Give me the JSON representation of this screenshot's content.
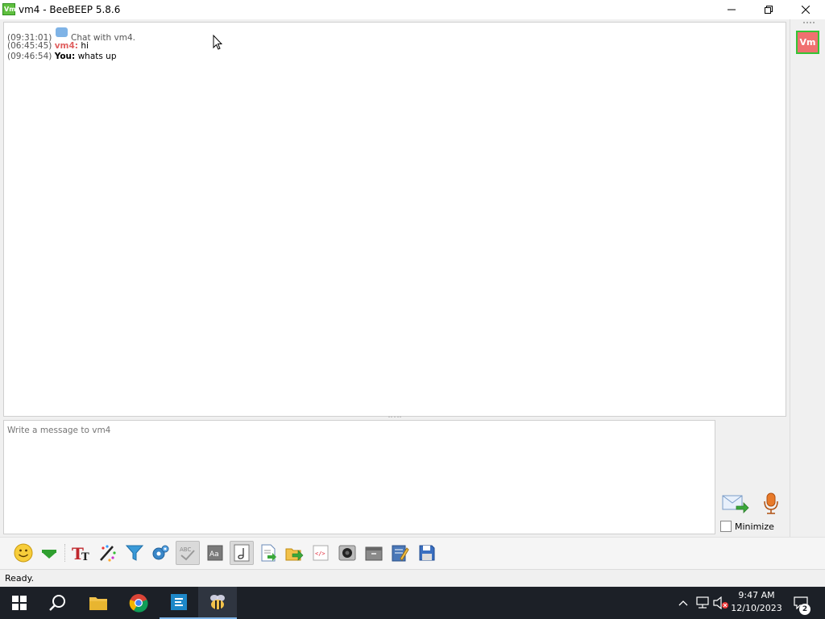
{
  "window": {
    "app_icon_text": "Vm",
    "title": "vm4 - BeeBEEP 5.8.6"
  },
  "chat": {
    "lines": [
      {
        "time": "(09:31:01)",
        "nick": "",
        "text": "Chat with vm4."
      },
      {
        "time": "(06:45:45)",
        "nick": "vm4:",
        "text": " hi"
      },
      {
        "time": "(09:46:54)",
        "nick": "You:",
        "text": " whats up"
      }
    ]
  },
  "user_panel": {
    "avatar_text": "Vm"
  },
  "input": {
    "placeholder": "Write a message to vm4",
    "minimize_label": "Minimize"
  },
  "toolbar": {
    "buttons": [
      "emoticons-icon",
      "down-arrow-icon",
      "font-icon",
      "pen-color-icon",
      "filter-icon",
      "settings-icon",
      "spellcheck-icon",
      "font-style-icon",
      "note-icon",
      "save-chat-icon",
      "send-file-icon",
      "code-icon",
      "screenshot-icon",
      "archive-icon",
      "edit-icon",
      "save-icon"
    ]
  },
  "status": {
    "text": "Ready."
  },
  "taskbar": {
    "time": "9:47 AM",
    "date": "12/10/2023",
    "notification_count": "2"
  },
  "colors": {
    "accent": "#5fbf3f",
    "nick_remote": "#e06060",
    "taskbar": "#1c2027"
  }
}
